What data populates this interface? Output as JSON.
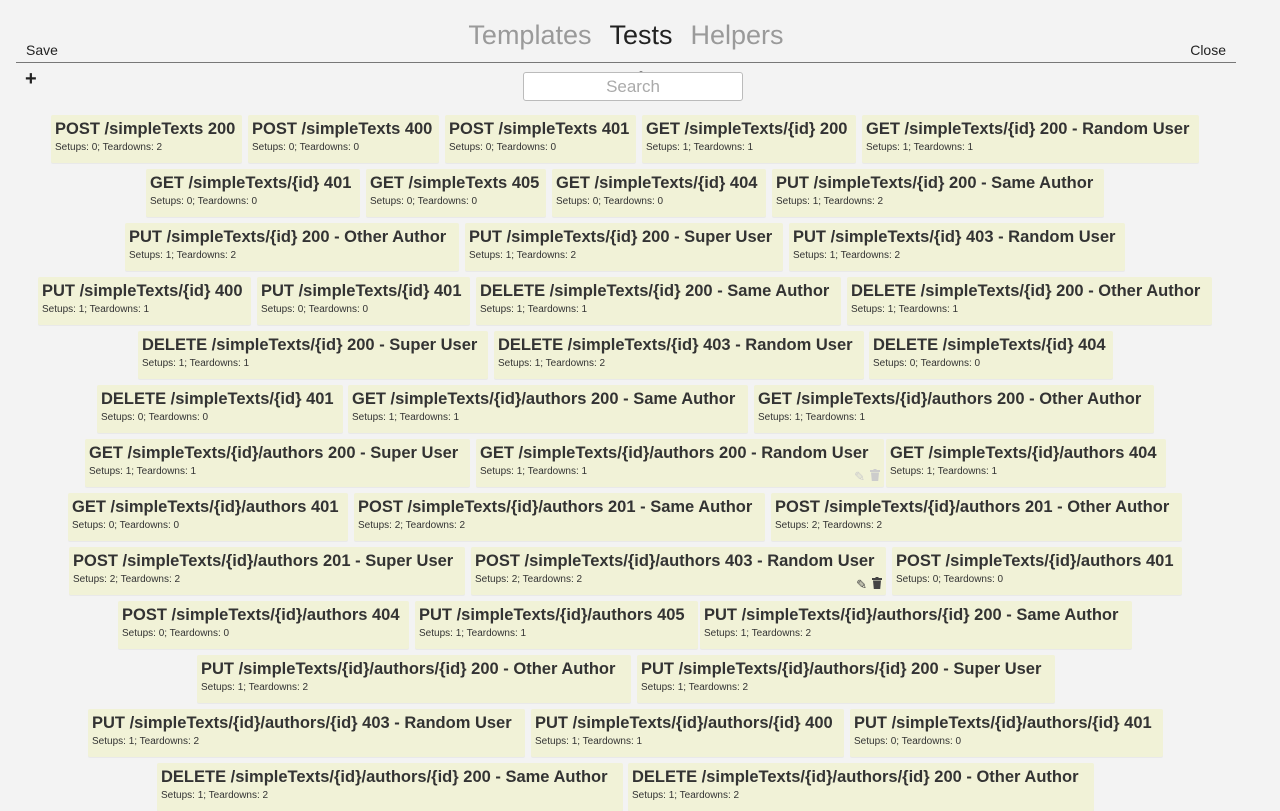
{
  "header": {
    "save_label": "Save",
    "close_label": "Close",
    "tabs": [
      {
        "label": "Templates",
        "active": false
      },
      {
        "label": "Tests",
        "active": true
      },
      {
        "label": "Helpers",
        "active": false
      }
    ]
  },
  "toolbar": {
    "add_label": "+"
  },
  "search": {
    "placeholder": "Search",
    "value": ""
  },
  "tests": [
    {
      "title": "POST /simpleTexts 200",
      "meta": "Setups: 0; Teardowns: 2"
    },
    {
      "title": "POST /simpleTexts 400",
      "meta": "Setups: 0; Teardowns: 0"
    },
    {
      "title": "POST /simpleTexts 401",
      "meta": "Setups: 0; Teardowns: 0"
    },
    {
      "title": "GET /simpleTexts/{id} 200",
      "meta": "Setups: 1; Teardowns: 1"
    },
    {
      "title": "GET /simpleTexts/{id} 200 - Random User",
      "meta": "Setups: 1; Teardowns: 1"
    },
    {
      "title": "GET /simpleTexts/{id} 401",
      "meta": "Setups: 0; Teardowns: 0"
    },
    {
      "title": "GET /simpleTexts 405",
      "meta": "Setups: 0; Teardowns: 0"
    },
    {
      "title": "GET /simpleTexts/{id} 404",
      "meta": "Setups: 0; Teardowns: 0"
    },
    {
      "title": "PUT /simpleTexts/{id} 200 - Same Author",
      "meta": "Setups: 1; Teardowns: 2"
    },
    {
      "title": "PUT /simpleTexts/{id} 200 - Other Author",
      "meta": "Setups: 1; Teardowns: 2"
    },
    {
      "title": "PUT /simpleTexts/{id} 200 - Super User",
      "meta": "Setups: 1; Teardowns: 2"
    },
    {
      "title": "PUT /simpleTexts/{id} 403 - Random User",
      "meta": "Setups: 1; Teardowns: 2"
    },
    {
      "title": "PUT /simpleTexts/{id} 400",
      "meta": "Setups: 1; Teardowns: 1"
    },
    {
      "title": "PUT /simpleTexts/{id} 401",
      "meta": "Setups: 0; Teardowns: 0"
    },
    {
      "title": "DELETE /simpleTexts/{id} 200 - Same Author",
      "meta": "Setups: 1; Teardowns: 1"
    },
    {
      "title": "DELETE /simpleTexts/{id} 200 - Other Author",
      "meta": "Setups: 1; Teardowns: 1"
    },
    {
      "title": "DELETE /simpleTexts/{id} 200 - Super User",
      "meta": "Setups: 1; Teardowns: 1"
    },
    {
      "title": "DELETE /simpleTexts/{id} 403 - Random User",
      "meta": "Setups: 1; Teardowns: 2"
    },
    {
      "title": "DELETE /simpleTexts/{id} 404",
      "meta": "Setups: 0; Teardowns: 0"
    },
    {
      "title": "DELETE /simpleTexts/{id} 401",
      "meta": "Setups: 0; Teardowns: 0"
    },
    {
      "title": "GET /simpleTexts/{id}/authors 200 - Same Author",
      "meta": "Setups: 1; Teardowns: 1"
    },
    {
      "title": "GET /simpleTexts/{id}/authors 200 - Other Author",
      "meta": "Setups: 1; Teardowns: 1"
    },
    {
      "title": "GET /simpleTexts/{id}/authors 200 - Super User",
      "meta": "Setups: 1; Teardowns: 1"
    },
    {
      "title": "GET /simpleTexts/{id}/authors 200 - Random User",
      "meta": "Setups: 1; Teardowns: 1",
      "actions": "faint"
    },
    {
      "title": "GET /simpleTexts/{id}/authors 404",
      "meta": "Setups: 1; Teardowns: 1"
    },
    {
      "title": "GET /simpleTexts/{id}/authors 401",
      "meta": "Setups: 0; Teardowns: 0"
    },
    {
      "title": "POST /simpleTexts/{id}/authors 201 - Same Author",
      "meta": "Setups: 2; Teardowns: 2"
    },
    {
      "title": "POST /simpleTexts/{id}/authors 201 - Other Author",
      "meta": "Setups: 2; Teardowns: 2"
    },
    {
      "title": "POST /simpleTexts/{id}/authors 201 - Super User",
      "meta": "Setups: 2; Teardowns: 2"
    },
    {
      "title": "POST /simpleTexts/{id}/authors 403 - Random User",
      "meta": "Setups: 2; Teardowns: 2",
      "actions": "solid"
    },
    {
      "title": "POST /simpleTexts/{id}/authors 401",
      "meta": "Setups: 0; Teardowns: 0"
    },
    {
      "title": "POST /simpleTexts/{id}/authors 404",
      "meta": "Setups: 0; Teardowns: 0"
    },
    {
      "title": "PUT /simpleTexts/{id}/authors 405",
      "meta": "Setups: 1; Teardowns: 1"
    },
    {
      "title": "PUT /simpleTexts/{id}/authors/{id} 200 - Same Author",
      "meta": "Setups: 1; Teardowns: 2"
    },
    {
      "title": "PUT /simpleTexts/{id}/authors/{id} 200 - Other Author",
      "meta": "Setups: 1; Teardowns: 2"
    },
    {
      "title": "PUT /simpleTexts/{id}/authors/{id} 200 - Super User",
      "meta": "Setups: 1; Teardowns: 2"
    },
    {
      "title": "PUT /simpleTexts/{id}/authors/{id} 403 - Random User",
      "meta": "Setups: 1; Teardowns: 2"
    },
    {
      "title": "PUT /simpleTexts/{id}/authors/{id} 400",
      "meta": "Setups: 1; Teardowns: 1"
    },
    {
      "title": "PUT /simpleTexts/{id}/authors/{id} 401",
      "meta": "Setups: 0; Teardowns: 0"
    },
    {
      "title": "DELETE /simpleTexts/{id}/authors/{id} 200 - Same Author",
      "meta": "Setups: 1; Teardowns: 2"
    },
    {
      "title": "DELETE /simpleTexts/{id}/authors/{id} 200 - Other Author",
      "meta": "Setups: 1; Teardowns: 2"
    }
  ],
  "icons": {
    "edit": "edit-icon",
    "delete": "trash-icon"
  }
}
